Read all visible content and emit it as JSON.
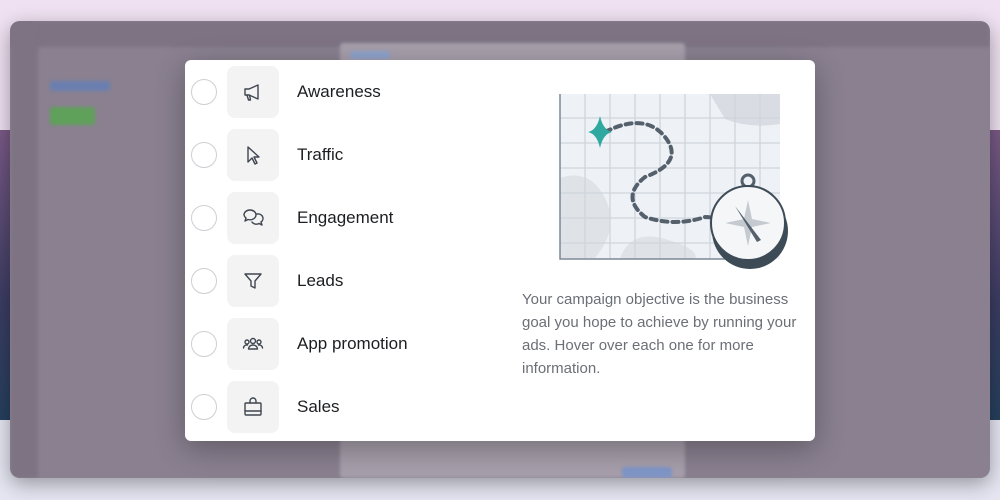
{
  "objectives": [
    {
      "label": "Awareness",
      "icon": "megaphone-icon",
      "selected": false
    },
    {
      "label": "Traffic",
      "icon": "cursor-icon",
      "selected": false
    },
    {
      "label": "Engagement",
      "icon": "chat-bubbles-icon",
      "selected": false
    },
    {
      "label": "Leads",
      "icon": "funnel-icon",
      "selected": false
    },
    {
      "label": "App promotion",
      "icon": "people-icon",
      "selected": false
    },
    {
      "label": "Sales",
      "icon": "shopping-bag-icon",
      "selected": false
    }
  ],
  "description": "Your campaign objective is the business goal you hope to achieve by running your ads. Hover over each one for more information.",
  "colors": {
    "accent": "#2fa8a0",
    "compass": "#3d4b57"
  }
}
